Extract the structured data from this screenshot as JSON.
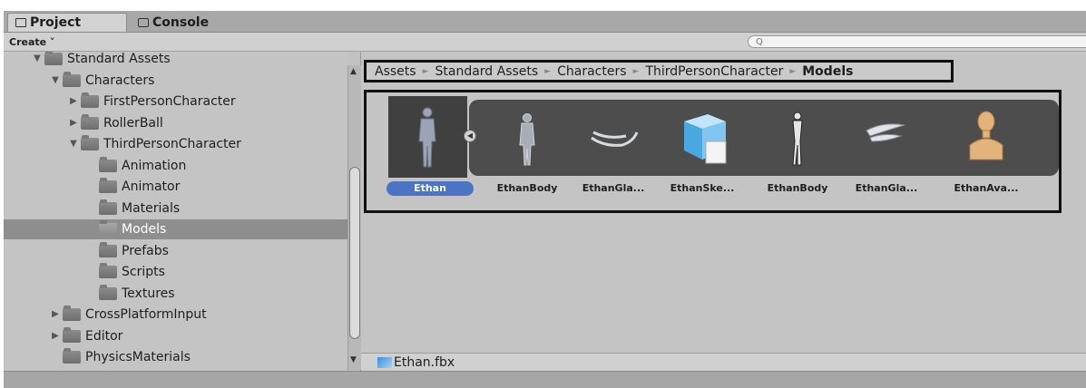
{
  "tabs": {
    "project": "Project",
    "console": "Console"
  },
  "toolbar": {
    "create_label": "Create ˅",
    "search_placeholder": "Q"
  },
  "tree": {
    "items": [
      {
        "label": "Standard Assets",
        "arrow": "▼",
        "indent": 0
      },
      {
        "label": "Characters",
        "arrow": "▼",
        "indent": 1
      },
      {
        "label": "FirstPersonCharacter",
        "arrow": "▶",
        "indent": 2
      },
      {
        "label": "RollerBall",
        "arrow": "▶",
        "indent": 2
      },
      {
        "label": "ThirdPersonCharacter",
        "arrow": "▼",
        "indent": 2
      },
      {
        "label": "Animation",
        "arrow": "",
        "indent": 3
      },
      {
        "label": "Animator",
        "arrow": "",
        "indent": 3
      },
      {
        "label": "Materials",
        "arrow": "",
        "indent": 3
      },
      {
        "label": "Models",
        "arrow": "",
        "indent": 3,
        "selected": true
      },
      {
        "label": "Prefabs",
        "arrow": "",
        "indent": 3
      },
      {
        "label": "Scripts",
        "arrow": "",
        "indent": 3
      },
      {
        "label": "Textures",
        "arrow": "",
        "indent": 3
      },
      {
        "label": "CrossPlatformInput",
        "arrow": "▶",
        "indent": 1
      },
      {
        "label": "Editor",
        "arrow": "▶",
        "indent": 1
      },
      {
        "label": "PhysicsMaterials",
        "arrow": "",
        "indent": 1
      }
    ]
  },
  "breadcrumb": {
    "items": [
      "Assets",
      "Standard Assets",
      "Characters",
      "ThirdPersonCharacter",
      "Models"
    ],
    "separator": "►"
  },
  "assets": [
    {
      "label": "Ethan",
      "icon": "humanoid-model-icon",
      "selected": true
    },
    {
      "label": "EthanBody",
      "icon": "humanoid-mesh-icon"
    },
    {
      "label": "EthanGla...",
      "icon": "glasses-mesh-icon"
    },
    {
      "label": "EthanSke...",
      "icon": "prefab-cube-icon"
    },
    {
      "label": "EthanBody",
      "icon": "body-texture-icon"
    },
    {
      "label": "EthanGla...",
      "icon": "glasses-texture-icon"
    },
    {
      "label": "EthanAva...",
      "icon": "avatar-bust-icon"
    }
  ],
  "status": {
    "file_name": "Ethan.fbx"
  },
  "colors": {
    "selection_blue": "#4a74c4",
    "strip_dark": "#4d4d4d",
    "panel_gray": "#c4c4c4"
  }
}
